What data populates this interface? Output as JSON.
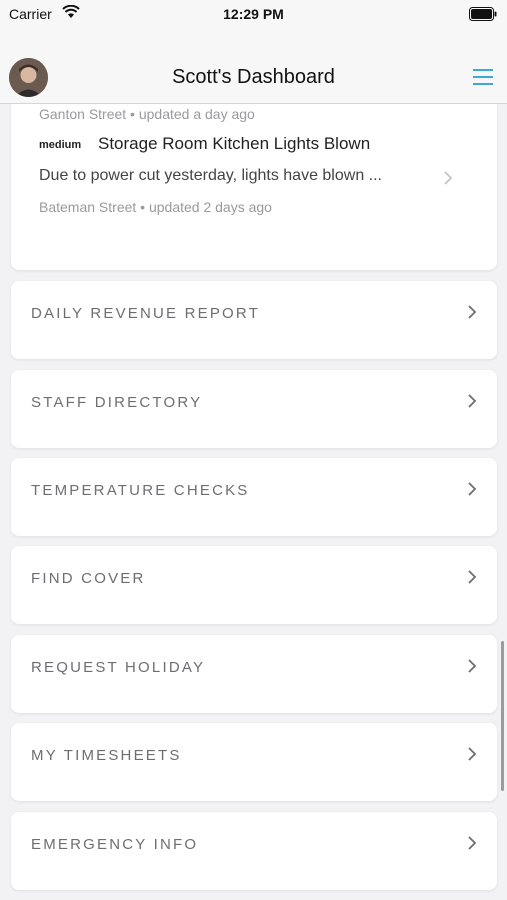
{
  "status_bar": {
    "carrier": "Carrier",
    "time": "12:29 PM"
  },
  "header": {
    "title": "Scott's Dashboard"
  },
  "issues": {
    "previous_meta": "Ganton Street • updated a day ago",
    "items": [
      {
        "priority": "medium",
        "title": "Storage Room Kitchen Lights Blown",
        "description": "Due to power cut yesterday, lights have blown ...",
        "meta": "Bateman Street • updated 2 days ago"
      }
    ]
  },
  "menu": [
    {
      "label": "DAILY REVENUE REPORT"
    },
    {
      "label": "STAFF DIRECTORY"
    },
    {
      "label": "TEMPERATURE CHECKS"
    },
    {
      "label": "FIND COVER"
    },
    {
      "label": "REQUEST HOLIDAY"
    },
    {
      "label": "MY TIMESHEETS"
    },
    {
      "label": "EMERGENCY INFO"
    }
  ],
  "colors": {
    "accent": "#3fa9d6",
    "label": "#6e6e72",
    "meta": "#9a9a9e"
  },
  "icons": [
    "wifi-icon",
    "battery-icon",
    "menu-icon",
    "chevron-right-icon"
  ]
}
